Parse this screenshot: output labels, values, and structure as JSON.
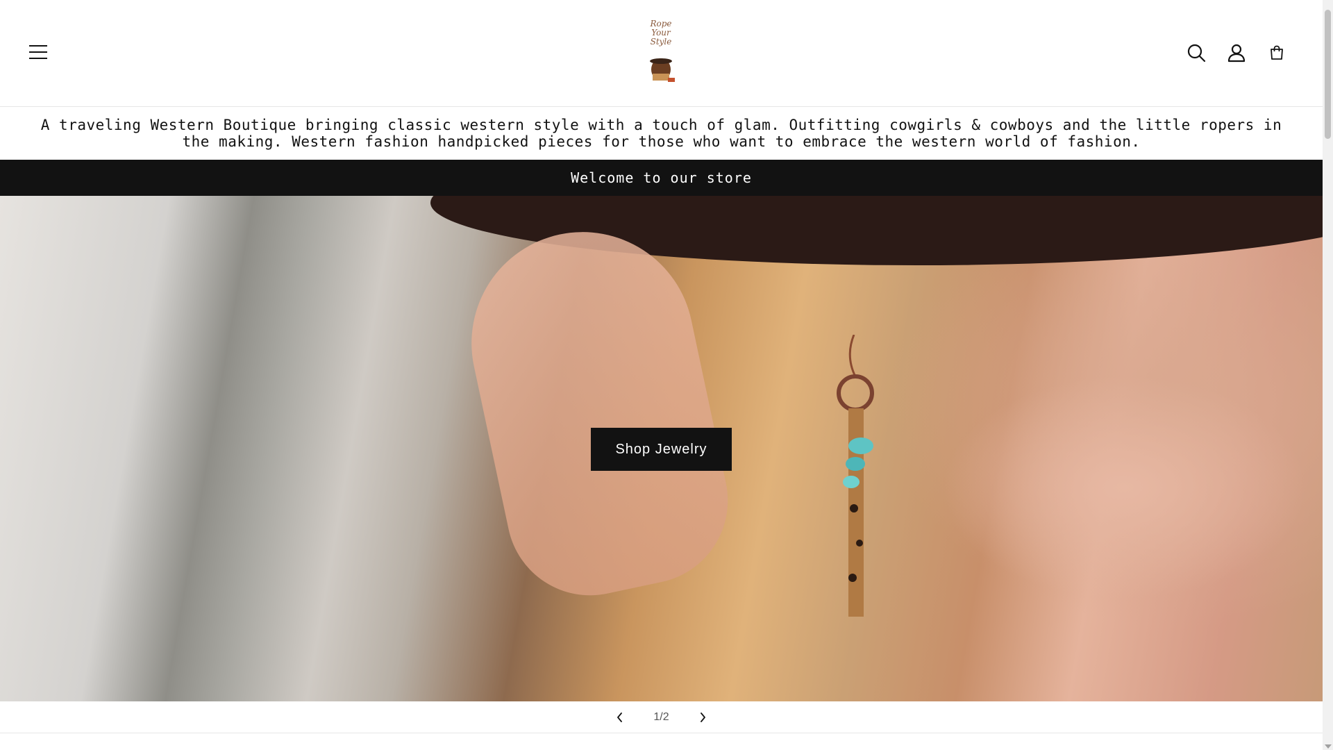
{
  "header": {
    "logo_text": "Rope Your Style",
    "menu_icon": "hamburger-menu-icon",
    "icons": [
      "search-icon",
      "account-icon",
      "cart-icon"
    ]
  },
  "tagline": {
    "text": "A traveling Western Boutique bringing classic western style with a touch of glam. Outfitting cowgirls & cowboys and the little ropers in the making. Western fashion handpicked pieces for those who want to embrace the western world of fashion."
  },
  "announcement": {
    "text": "Welcome to our store"
  },
  "hero": {
    "button_label": "Shop Jewelry"
  },
  "slider": {
    "counter": "1/2",
    "prev_icon": "chevron-left-icon",
    "next_icon": "chevron-right-icon"
  },
  "colors": {
    "text": "#121212",
    "bar_bg": "#121212",
    "button_bg": "#121212",
    "button_text": "#ffffff"
  }
}
